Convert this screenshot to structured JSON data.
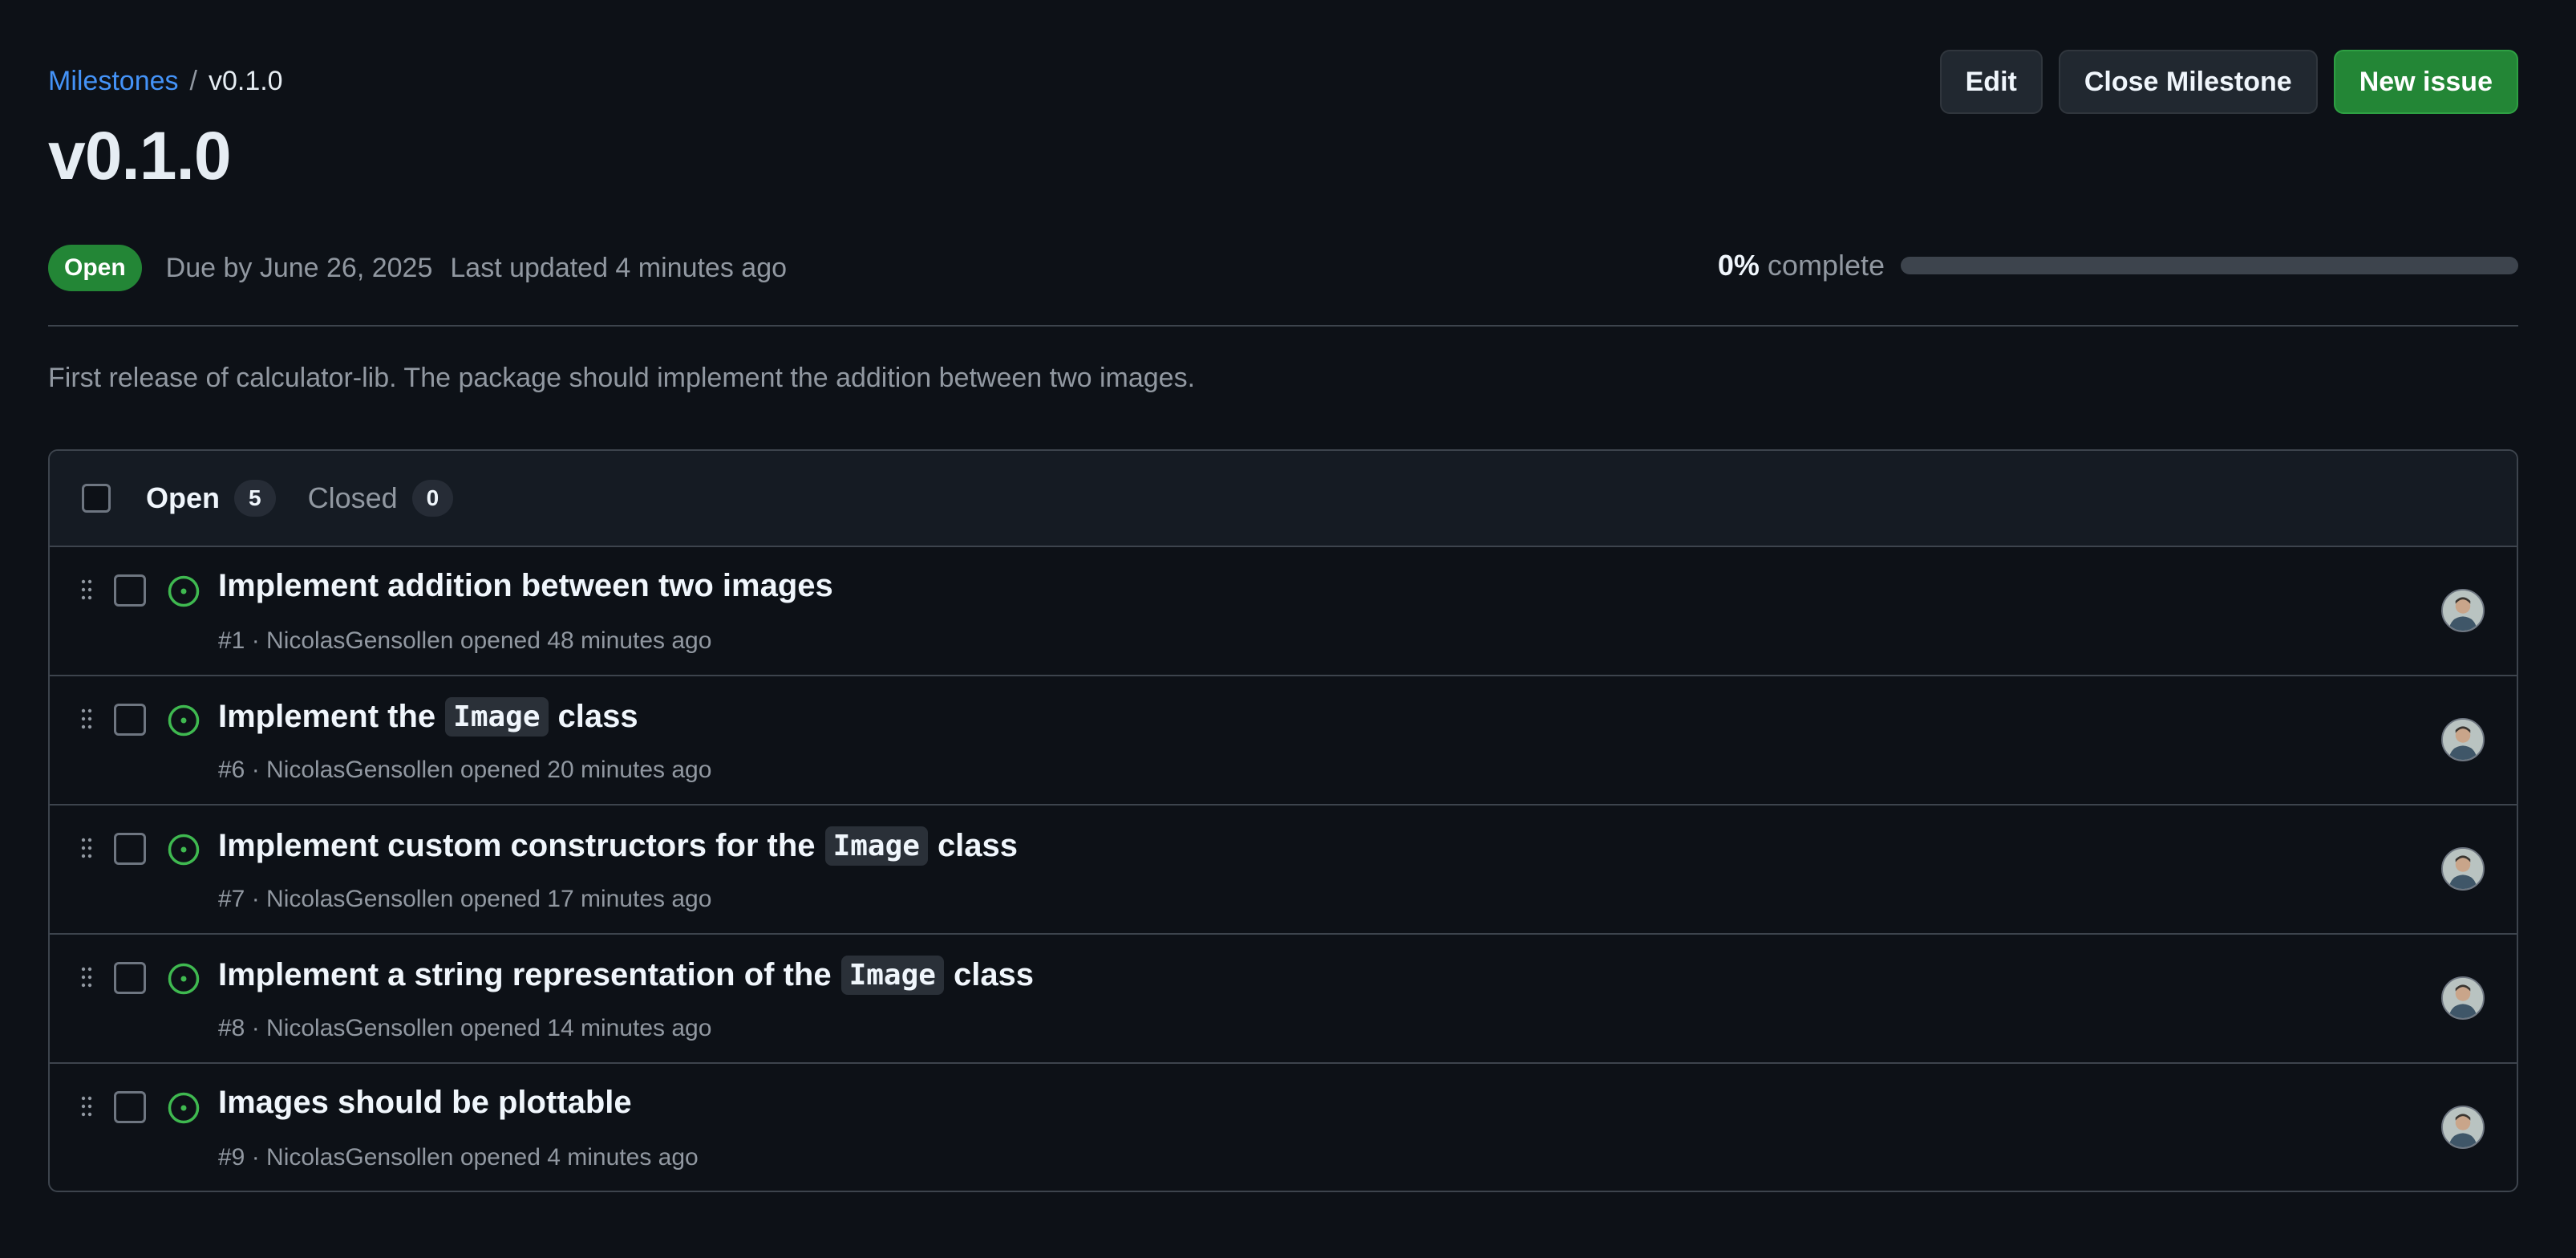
{
  "breadcrumb": {
    "parent": "Milestones",
    "separator": "/",
    "current": "v0.1.0"
  },
  "milestone": {
    "title": "v0.1.0",
    "state": "Open",
    "due": "Due by June 26, 2025",
    "updated": "Last updated 4 minutes ago",
    "progress_pct_label": "0%",
    "progress_word": "complete",
    "progress_fraction": 0,
    "description": "First release of calculator-lib. The package should implement the addition between two images."
  },
  "actions": {
    "edit": "Edit",
    "close": "Close Milestone",
    "new_issue": "New issue"
  },
  "tabs": {
    "open_label": "Open",
    "open_count": "5",
    "closed_label": "Closed",
    "closed_count": "0"
  },
  "issues": [
    {
      "title": "Implement addition between two images",
      "meta": "#1 · NicolasGensollen opened 48 minutes ago"
    },
    {
      "title_before": "Implement the",
      "code": "Image",
      "title_after": "class",
      "meta": "#6 · NicolasGensollen opened 20 minutes ago"
    },
    {
      "title_before": "Implement custom constructors for the",
      "code": "Image",
      "title_after": "class",
      "meta": "#7 · NicolasGensollen opened 17 minutes ago"
    },
    {
      "title_before": "Implement a string representation of the",
      "code": "Image",
      "title_after": "class",
      "meta": "#8 · NicolasGensollen opened 14 minutes ago"
    },
    {
      "title": "Images should be plottable",
      "meta": "#9 · NicolasGensollen opened 4 minutes ago"
    }
  ],
  "icons": {
    "drag": "grabber-icon",
    "issue_open": "issue-opened-icon",
    "avatar": "user-avatar"
  },
  "colors": {
    "accent_link": "#4493f8",
    "open_green": "#238636",
    "issue_icon_green": "#3fb950"
  }
}
